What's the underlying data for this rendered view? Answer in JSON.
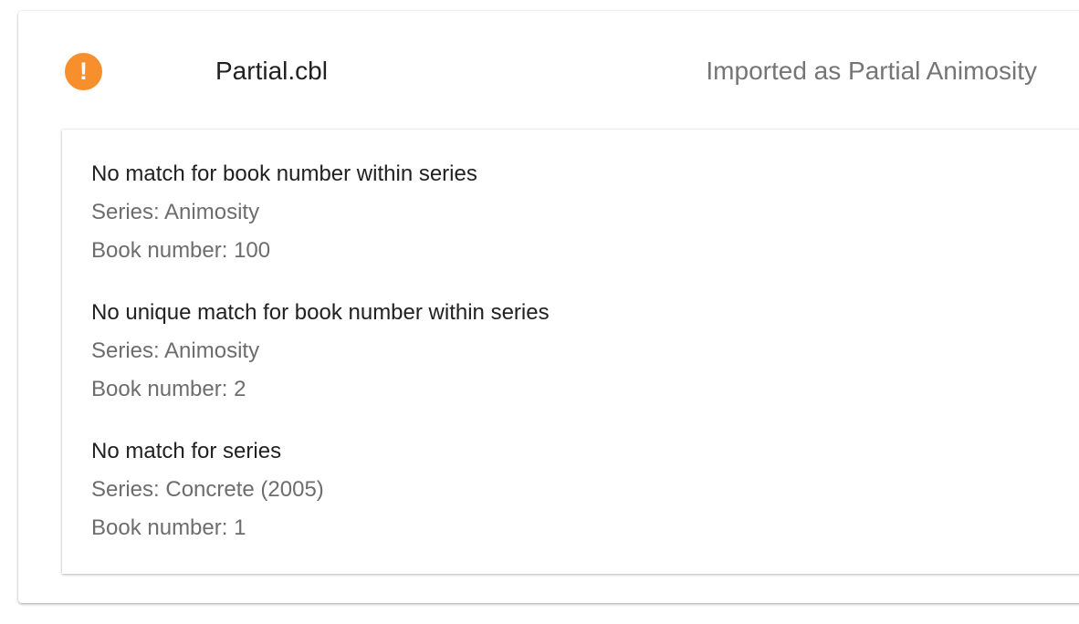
{
  "header": {
    "status_icon": "warning-exclamation-icon",
    "status_icon_glyph": "!",
    "status_color": "#f7902c",
    "file_name": "Partial.cbl",
    "result_text": "Imported as Partial Animosity"
  },
  "issues": [
    {
      "title": "No match for book number within series",
      "series": "Series: Animosity",
      "book_number": "Book number: 100"
    },
    {
      "title": "No unique match for book number within series",
      "series": "Series: Animosity",
      "book_number": "Book number: 2"
    },
    {
      "title": "No match for series",
      "series": "Series: Concrete (2005)",
      "book_number": "Book number: 1"
    }
  ]
}
